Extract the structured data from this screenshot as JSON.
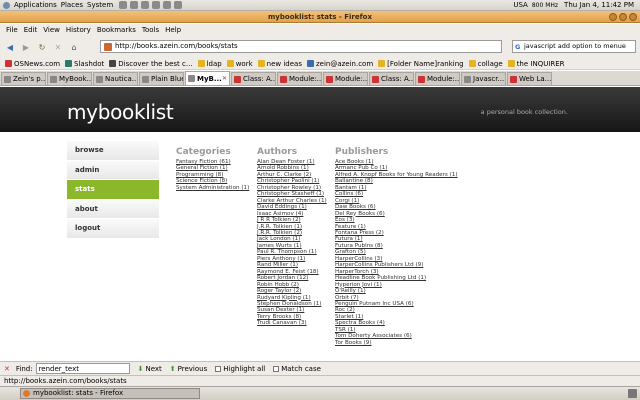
{
  "topbar": {
    "menus": [
      "Applications",
      "Places",
      "System"
    ],
    "status_text": "USA",
    "cpu": "800 MHz",
    "clock": "Thu Jan  4, 11:42 PM"
  },
  "window": {
    "title": "mybooklist: stats - Firefox"
  },
  "menubar": [
    "File",
    "Edit",
    "View",
    "History",
    "Bookmarks",
    "Tools",
    "Help"
  ],
  "navbar": {
    "url": "http://books.azein.com/books/stats",
    "search_value": "javascript add option to menue"
  },
  "bookmarks": [
    {
      "label": "OSNews.com",
      "color": "#cc3333"
    },
    {
      "label": "Slashdot",
      "color": "#2a7a6a"
    },
    {
      "label": "Discover the best c...",
      "color": "#444444"
    },
    {
      "label": "ldap",
      "color": "#e6b422"
    },
    {
      "label": "work",
      "color": "#e6b422"
    },
    {
      "label": "new ideas",
      "color": "#e6b422"
    },
    {
      "label": "zein@azein.com",
      "color": "#3a6ab0"
    },
    {
      "label": "[Folder Name]ranking",
      "color": "#e6b422"
    },
    {
      "label": "collage",
      "color": "#e6b422"
    },
    {
      "label": "the INQUIRER",
      "color": "#e6b422"
    }
  ],
  "tabs": [
    {
      "label": "Zein's p...",
      "color": "#888888",
      "active": false
    },
    {
      "label": "MyBook...",
      "color": "#888888",
      "active": false
    },
    {
      "label": "Nautica...",
      "color": "#888888",
      "active": false
    },
    {
      "label": "Plain Blue",
      "color": "#888888",
      "active": false
    },
    {
      "label": "MyB...",
      "color": "#888888",
      "active": true
    },
    {
      "label": "Class: A...",
      "color": "#cc3333",
      "active": false
    },
    {
      "label": "Module:...",
      "color": "#cc3333",
      "active": false
    },
    {
      "label": "Module:...",
      "color": "#cc3333",
      "active": false
    },
    {
      "label": "Class: A...",
      "color": "#cc3333",
      "active": false
    },
    {
      "label": "Module:...",
      "color": "#cc3333",
      "active": false
    },
    {
      "label": "Javascr...",
      "color": "#888888",
      "active": false
    },
    {
      "label": "Web La...",
      "color": "#cc3333",
      "active": false
    }
  ],
  "site": {
    "logo": "mybooklist",
    "tagline": "a personal book collection."
  },
  "sidenav": [
    {
      "label": "browse",
      "active": false
    },
    {
      "label": "admin",
      "active": false
    },
    {
      "label": "stats",
      "active": true
    },
    {
      "label": "about",
      "active": false
    },
    {
      "label": "logout",
      "active": false
    }
  ],
  "categories": {
    "heading": "Categories",
    "items": [
      "Fantasy Fiction (61)",
      "General Fiction (1)",
      "Programming (8)",
      "Science Fiction (8)",
      "System Administration (1)"
    ]
  },
  "authors": {
    "heading": "Authors",
    "items": [
      "Alan Dean Foster (1)",
      "Arnold Robbins (1)",
      "Arthur C. Clarke (2)",
      "Christopher Paolini (1)",
      "Christopher Rowley (1)",
      "Christopher Stasheff (1)",
      "Clarke Arthur Charles (1)",
      "David Eddings (1)",
      "Isaac Asimov (4)",
      "J R R Tolkien (2)",
      "J.R.R. Tolkien (1)",
      "J.R.R. Tolkien (2)",
      "Jack London (1)",
      "James Wurts (1)",
      "Paul R. Thompson (1)",
      "Piers Anthony (1)",
      "Rand Miller (1)",
      "Raymond E. Feist (18)",
      "Robert Jordan (12)",
      "Robin Hobb (2)",
      "Roger Taylor (2)",
      "Rudyard Kipling (1)",
      "Stephen Donaldson (1)",
      "Susan Dexter (1)",
      "Terry Brooks (8)",
      "Trudi Canavan (3)"
    ]
  },
  "publishers": {
    "heading": "Publishers",
    "items": [
      "Ace Books (1)",
      "Armanc Pub Co (1)",
      "Alfred A. Knopf Books for Young Readers (1)",
      "Ballantine (8)",
      "Bantam (1)",
      "Collins (6)",
      "Corgi (1)",
      "Daw Books (6)",
      "Del Rey Books (6)",
      "Eos (3)",
      "Feature (1)",
      "Fontana Press (2)",
      "Futura (1)",
      "Futura Publns (8)",
      "Grafton (5)",
      "HarperCollins (3)",
      "HarperCollins Publishers Ltd (9)",
      "HarperTorch (3)",
      "Headline Book Publishing Ltd (1)",
      "Hyperion Jovi (1)",
      "O'Reilly (1)",
      "Orbit (7)",
      "Penguin Putnam Inc USA (6)",
      "Roc (2)",
      "Starlet (1)",
      "Spectra Books (4)",
      "TSR (1)",
      "Tom Doherty Associates (6)",
      "Tor Books (9)"
    ]
  },
  "findbar": {
    "label": "Find:",
    "value": "render_text",
    "next": "Next",
    "previous": "Previous",
    "highlight": "Highlight all",
    "match_case": "Match case"
  },
  "statusbar": {
    "text": "http://books.azein.com/books/stats"
  },
  "taskbar": {
    "window_label": "mybooklist: stats - Firefox"
  }
}
